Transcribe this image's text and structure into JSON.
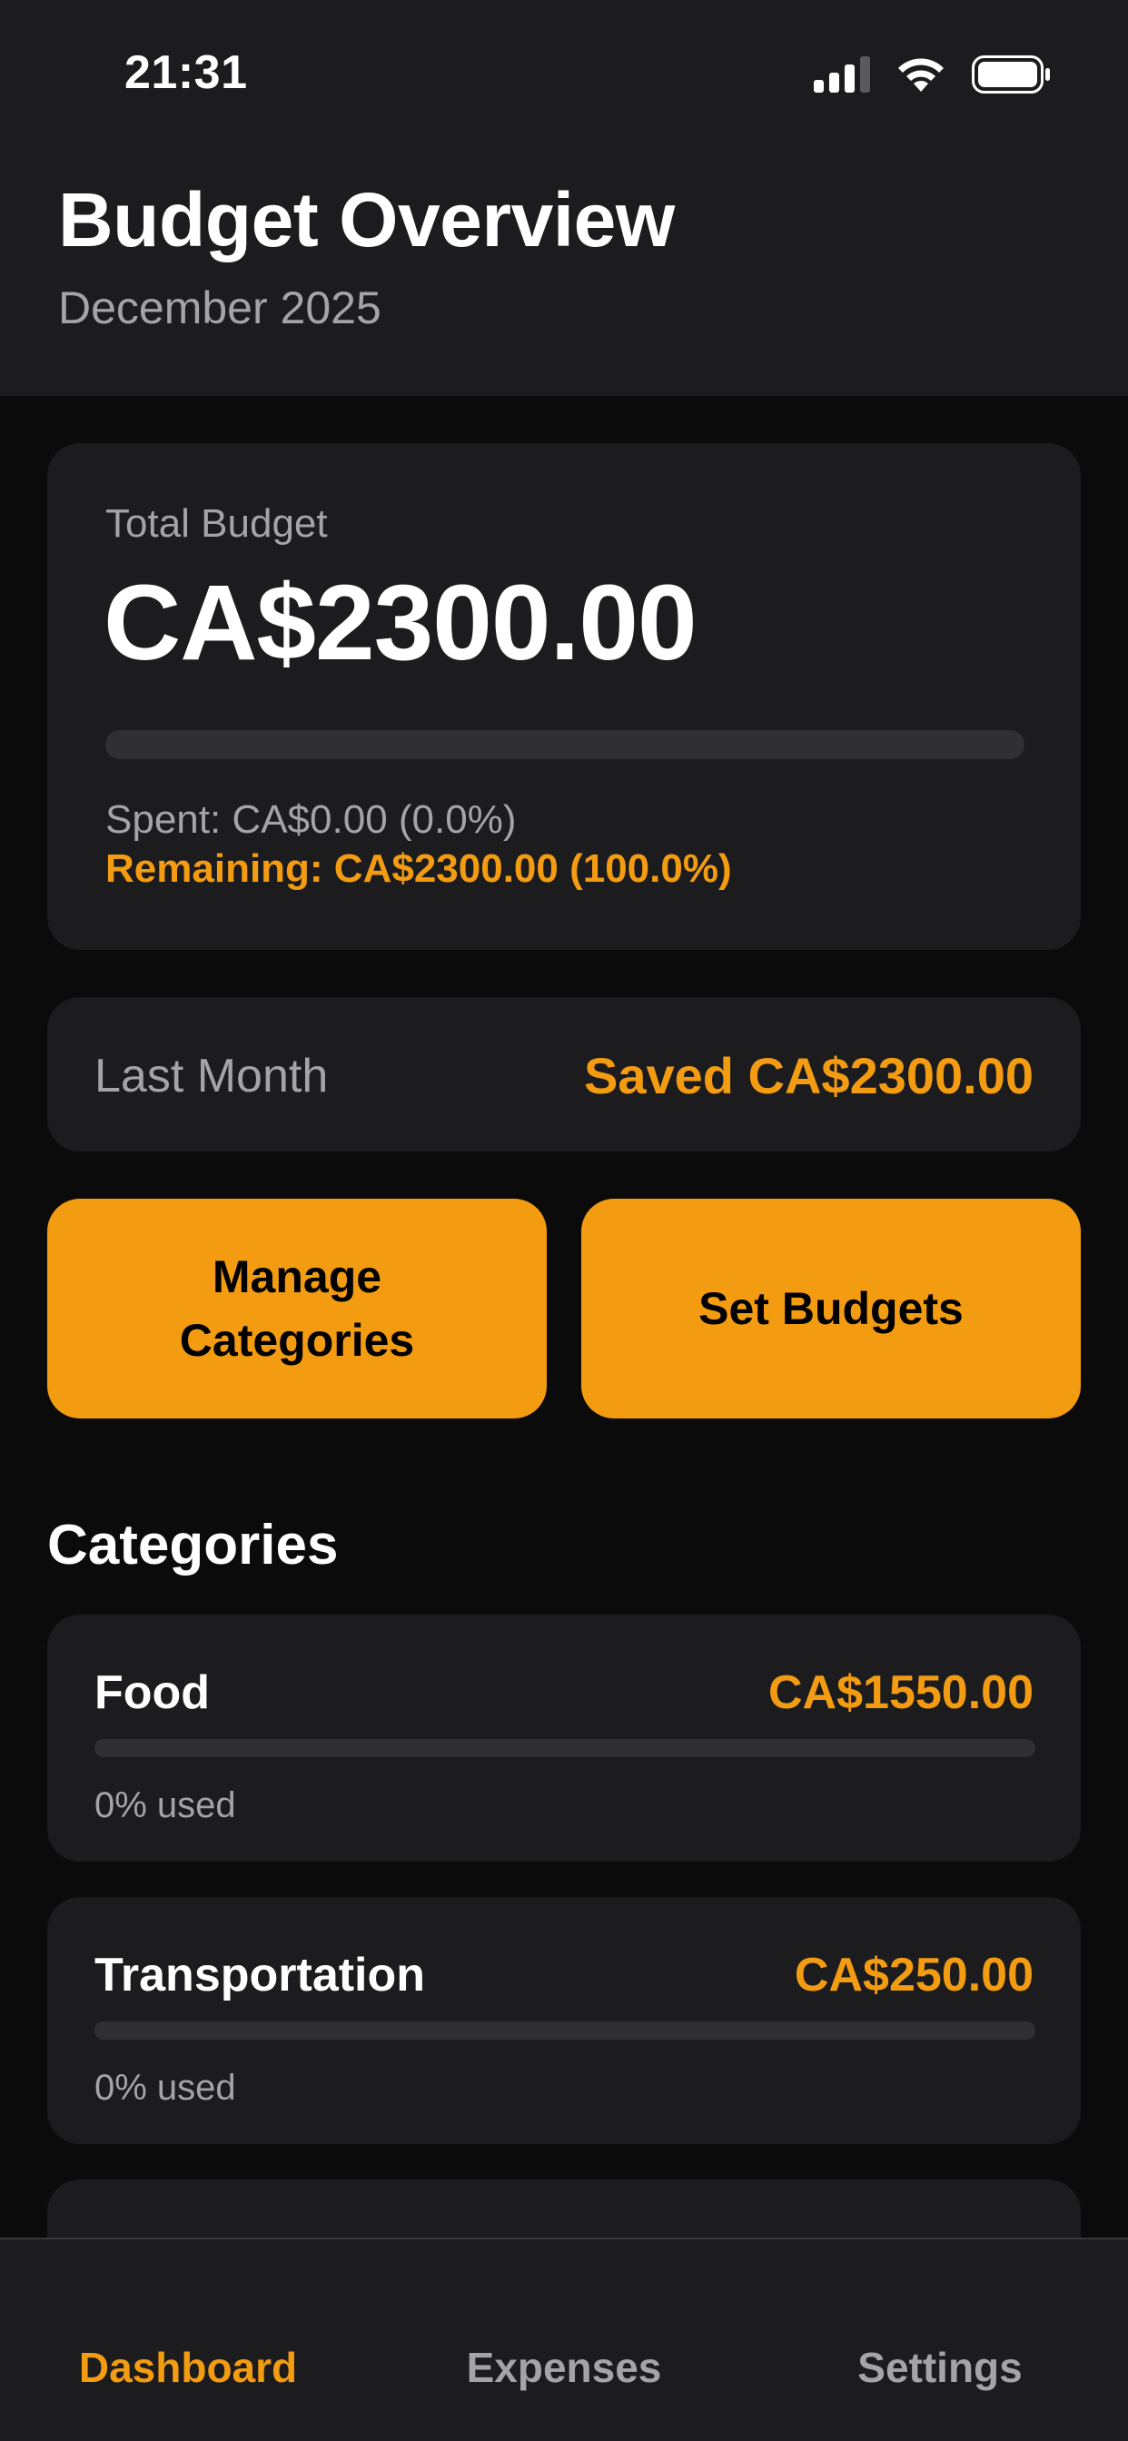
{
  "status_bar": {
    "time": "21:31"
  },
  "header": {
    "title": "Budget Overview",
    "subtitle": "December 2025"
  },
  "total": {
    "label": "Total Budget",
    "amount": "CA$2300.00",
    "spent_text": "Spent: CA$0.00 (0.0%)",
    "remaining_text": "Remaining: CA$2300.00 (100.0%)",
    "spent_fraction": 0
  },
  "last_month": {
    "label": "Last Month",
    "value": "Saved CA$2300.00"
  },
  "actions": {
    "manage_categories": "Manage Categories",
    "set_budgets": "Set Budgets"
  },
  "categories_heading": "Categories",
  "categories": [
    {
      "name": "Food",
      "amount": "CA$1550.00",
      "used_text": "0% used",
      "used_fraction": 0
    },
    {
      "name": "Transportation",
      "amount": "CA$250.00",
      "used_text": "0% used",
      "used_fraction": 0
    }
  ],
  "tabs": [
    {
      "label": "Dashboard",
      "active": true
    },
    {
      "label": "Expenses",
      "active": false
    },
    {
      "label": "Settings",
      "active": false
    }
  ],
  "colors": {
    "accent": "#f39c12",
    "background": "#0b0b0b",
    "card": "#1c1c1e",
    "track": "#303033",
    "secondary_text": "#a3a3a8"
  },
  "icons": [
    "cellular-signal-icon",
    "wifi-icon",
    "battery-icon"
  ]
}
